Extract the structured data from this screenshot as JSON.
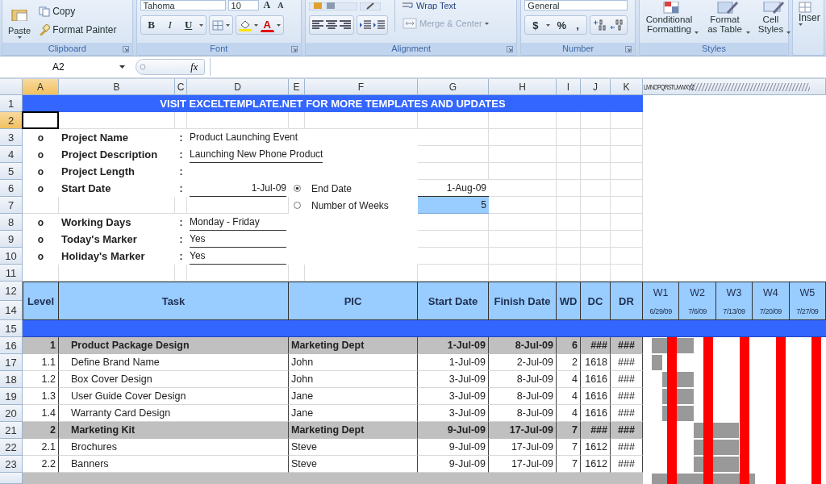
{
  "ribbon": {
    "groups": [
      {
        "kind": "clipboard",
        "label": "Clipboard",
        "paste": "Paste",
        "items": [
          "Copy",
          "Format Painter"
        ]
      },
      {
        "kind": "font",
        "label": "Font",
        "font_name": "Tahoma",
        "font_size": "10",
        "grow": "A",
        "shrink": "A",
        "buttons": [
          "B",
          "I",
          "U"
        ],
        "font_color": "A"
      },
      {
        "kind": "alignment",
        "label": "Alignment",
        "wrap": "Wrap Text",
        "merge": "Merge & Center",
        "merge_disabled": true
      },
      {
        "kind": "number",
        "label": "Number",
        "format": "General",
        "buttons": [
          "$",
          "%",
          ","
        ]
      },
      {
        "kind": "styles",
        "label": "Styles",
        "buttons": [
          "Conditional Formatting",
          "Format as Table",
          "Cell Styles"
        ]
      },
      {
        "kind": "cells",
        "buttons": [
          "Inser"
        ]
      }
    ]
  },
  "formula_bar": {
    "name_box": "A2",
    "fx": "fx"
  },
  "sheet": {
    "columns": [
      {
        "label": "A",
        "selected": true
      },
      {
        "label": "B",
        "selected": false
      },
      {
        "label": "C",
        "selected": false
      },
      {
        "label": "D",
        "selected": false
      },
      {
        "label": "E",
        "selected": false
      },
      {
        "label": "F",
        "selected": false
      },
      {
        "label": "G",
        "selected": false
      },
      {
        "label": "H",
        "selected": false
      },
      {
        "label": "I",
        "selected": false
      },
      {
        "label": "J",
        "selected": false
      },
      {
        "label": "K",
        "selected": false
      }
    ],
    "narrow_columns": "LMNOPQRSTUVWXYZ",
    "rows": [
      {
        "label": "1",
        "selected": false
      },
      {
        "label": "2",
        "selected": true
      },
      {
        "label": "3",
        "selected": false
      },
      {
        "label": "4",
        "selected": false
      },
      {
        "label": "5",
        "selected": false
      },
      {
        "label": "6",
        "selected": false
      },
      {
        "label": "7",
        "selected": false
      },
      {
        "label": "8",
        "selected": false
      },
      {
        "label": "9",
        "selected": false
      },
      {
        "label": "10",
        "selected": false
      },
      {
        "label": "11",
        "selected": false
      },
      {
        "label": "12",
        "selected": false
      },
      {
        "label": "14",
        "selected": false
      },
      {
        "label": "15",
        "selected": false
      },
      {
        "label": "16",
        "selected": false
      },
      {
        "label": "17",
        "selected": false
      },
      {
        "label": "18",
        "selected": false
      },
      {
        "label": "19",
        "selected": false
      },
      {
        "label": "20",
        "selected": false
      },
      {
        "label": "21",
        "selected": false
      },
      {
        "label": "22",
        "selected": false
      },
      {
        "label": "23",
        "selected": false
      }
    ],
    "banner": "VISIT EXCELTEMPLATE.NET FOR MORE TEMPLATES AND UPDATES",
    "info": [
      {
        "bullet": "o",
        "label": "Project Name",
        "colon": ":",
        "value": "Product Launching Event",
        "kind": "text",
        "underlined": false
      },
      {
        "bullet": "o",
        "label": "Project Description",
        "colon": ":",
        "value": "Launching New Phone Product",
        "kind": "text",
        "underlined": true
      },
      {
        "bullet": "o",
        "label": "Project Length",
        "colon": ":"
      },
      {
        "bullet": "o",
        "label": "Start Date",
        "colon": ":",
        "value": "1-Jul-09",
        "kind": "date",
        "underlined": true
      },
      {
        "bullet": "o",
        "label": "Working Days",
        "colon": ":",
        "value": "Monday - Friday",
        "kind": "text",
        "underlined": true
      },
      {
        "bullet": "o",
        "label": "Today's Marker",
        "colon": ":",
        "value": "Yes",
        "kind": "text",
        "underlined": true
      },
      {
        "bullet": "o",
        "label": "Holiday's Marker",
        "colon": ":",
        "value": "Yes",
        "kind": "text",
        "underlined": true
      }
    ],
    "options": [
      {
        "label": "End Date",
        "selected": true,
        "value": "1-Aug-09",
        "kind": "date"
      },
      {
        "label": "Number of Weeks",
        "selected": false,
        "value": "5",
        "kind": "number"
      }
    ],
    "table": {
      "columns": [
        "Level",
        "Task",
        "PIC",
        "Start Date",
        "Finish Date",
        "WD",
        "DC",
        "DR"
      ],
      "weeks": [
        {
          "label": "W1",
          "date": "6/29/09"
        },
        {
          "label": "W2",
          "date": "7/6/09"
        },
        {
          "label": "W3",
          "date": "7/13/09"
        },
        {
          "label": "W4",
          "date": "7/20/09"
        },
        {
          "label": "W5",
          "date": "7/27/09"
        }
      ],
      "rows": [
        {
          "kind": "group",
          "no": "1",
          "task": "Product Package Design",
          "pic": "Marketing Dept",
          "start": "1-Jul-09",
          "finish": "8-Jul-09",
          "wd": "6",
          "dc": "###",
          "dr": "###"
        },
        {
          "kind": "task",
          "no": "1.1",
          "task": "Define Brand Name",
          "pic": "John",
          "start": "1-Jul-09",
          "finish": "2-Jul-09",
          "wd": "2",
          "dc": "1618",
          "dr": "###"
        },
        {
          "kind": "task",
          "no": "1.2",
          "task": "Box Cover Design",
          "pic": "John",
          "start": "3-Jul-09",
          "finish": "8-Jul-09",
          "wd": "4",
          "dc": "1616",
          "dr": "###"
        },
        {
          "kind": "task",
          "no": "1.3",
          "task": "User Guide Cover Design",
          "pic": "Jane",
          "start": "3-Jul-09",
          "finish": "8-Jul-09",
          "wd": "4",
          "dc": "1616",
          "dr": "###"
        },
        {
          "kind": "task",
          "no": "1.4",
          "task": "Warranty Card Design",
          "pic": "Jane",
          "start": "3-Jul-09",
          "finish": "8-Jul-09",
          "wd": "4",
          "dc": "1616",
          "dr": "###"
        },
        {
          "kind": "group",
          "no": "2",
          "task": "Marketing Kit",
          "pic": "Marketing Dept",
          "start": "9-Jul-09",
          "finish": "17-Jul-09",
          "wd": "7",
          "dc": "###",
          "dr": "###"
        },
        {
          "kind": "task",
          "no": "2.1",
          "task": "Brochures",
          "pic": "Steve",
          "start": "9-Jul-09",
          "finish": "17-Jul-09",
          "wd": "7",
          "dc": "1612",
          "dr": "###"
        },
        {
          "kind": "task",
          "no": "2.2",
          "task": "Banners",
          "pic": "Steve",
          "start": "9-Jul-09",
          "finish": "17-Jul-09",
          "wd": "7",
          "dc": "1612",
          "dr": "###"
        }
      ]
    }
  }
}
